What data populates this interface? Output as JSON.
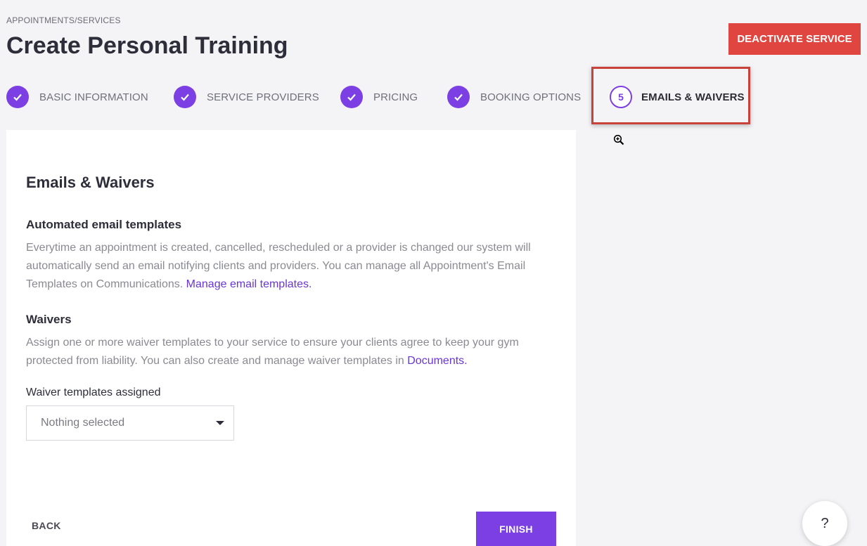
{
  "header": {
    "breadcrumb": "APPOINTMENTS/SERVICES",
    "title": "Create Personal Training",
    "deactivate_label": "DEACTIVATE SERVICE"
  },
  "stepper": {
    "steps": [
      {
        "label": "BASIC INFORMATION",
        "state": "complete"
      },
      {
        "label": "SERVICE PROVIDERS",
        "state": "complete"
      },
      {
        "label": "PRICING",
        "state": "complete"
      },
      {
        "label": "BOOKING OPTIONS",
        "state": "complete"
      },
      {
        "label": "EMAILS & WAIVERS",
        "state": "active",
        "number": "5"
      }
    ]
  },
  "main": {
    "heading": "Emails & Waivers",
    "email_section": {
      "title": "Automated email templates",
      "text": "Everytime an appointment is created, cancelled, rescheduled or a provider is changed our system will automatically send an email notifying clients and providers. You can manage all Appointment's Email Templates on Communications.",
      "link": "Manage email templates."
    },
    "waivers_section": {
      "title": "Waivers",
      "text": "Assign one or more waiver templates to your service to ensure your clients agree to keep your gym protected from liability. You can also create and manage waiver templates in",
      "link": "Documents."
    },
    "waiver_field": {
      "label": "Waiver templates assigned",
      "value": "Nothing selected"
    },
    "back_label": "BACK",
    "finish_label": "FINISH"
  },
  "help_label": "?",
  "colors": {
    "accent": "#7b3fe4",
    "danger": "#e0463f",
    "highlight": "#c8423b"
  }
}
